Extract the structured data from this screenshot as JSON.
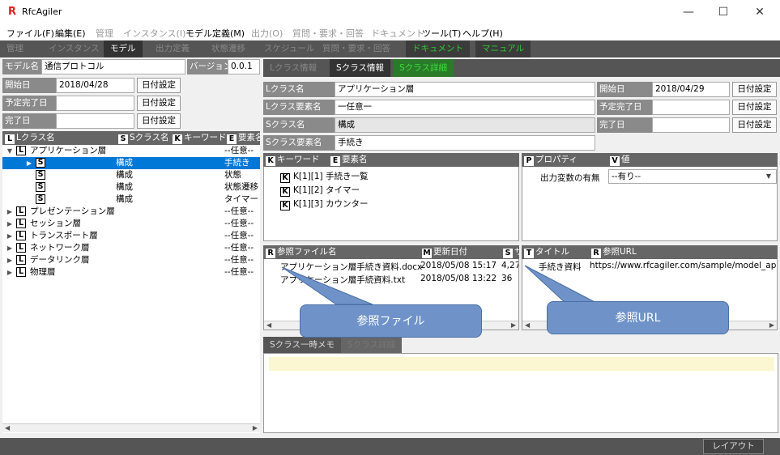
{
  "app": {
    "title": "RfcAgiler",
    "logo": "R"
  },
  "window_controls": {
    "minimize": "—",
    "maximize": "☐",
    "close": "✕"
  },
  "menu": [
    "ファイル(F)",
    "編集(E)",
    "管理",
    "インスタンス(I)",
    "モデル定義(M)",
    "出力(O)",
    "質問・要求・回答",
    "ドキュメント",
    "ツール(T)",
    "ヘルプ(H)"
  ],
  "top_tabs": [
    "管理",
    "インスタンス",
    "モデル",
    "出力定義",
    "状態遷移",
    "スケジュール",
    "質問・要求・回答",
    "ドキュメント",
    "マニュアル"
  ],
  "left": {
    "model_label": "モデル名",
    "model_value": "通信プロトコル",
    "version_label": "バージョン",
    "version_value": "0.0.1",
    "start_label": "開始日",
    "start_value": "2018/04/28",
    "planned_label": "予定完了日",
    "planned_value": "",
    "done_label": "完了日",
    "done_value": "",
    "date_btn": "日付設定",
    "tree_headers": {
      "l_badge": "L",
      "l": "Lクラス名",
      "s_badge": "S",
      "s": "Sクラス名",
      "k_badge": "K",
      "k": "キーワード",
      "e_badge": "E",
      "e": "要素名"
    },
    "tree": [
      {
        "arrow": "▼",
        "badge": "L",
        "name": "アプリケーション層",
        "s": "",
        "el": "--任意--",
        "indent": 0,
        "selected": false
      },
      {
        "arrow": "▶",
        "badge": "S",
        "name": "",
        "s": "構成",
        "el": "手続き",
        "indent": 1,
        "selected": true
      },
      {
        "arrow": "",
        "badge": "S",
        "name": "",
        "s": "構成",
        "el": "状態",
        "indent": 1,
        "selected": false
      },
      {
        "arrow": "",
        "badge": "S",
        "name": "",
        "s": "構成",
        "el": "状態遷移",
        "indent": 1,
        "selected": false
      },
      {
        "arrow": "",
        "badge": "S",
        "name": "",
        "s": "構成",
        "el": "タイマー",
        "indent": 1,
        "selected": false
      },
      {
        "arrow": "▶",
        "badge": "L",
        "name": "プレゼンテーション層",
        "s": "",
        "el": "--任意--",
        "indent": 0,
        "selected": false
      },
      {
        "arrow": "▶",
        "badge": "L",
        "name": "セッション層",
        "s": "",
        "el": "--任意--",
        "indent": 0,
        "selected": false
      },
      {
        "arrow": "▶",
        "badge": "L",
        "name": "トランスポート層",
        "s": "",
        "el": "--任意--",
        "indent": 0,
        "selected": false
      },
      {
        "arrow": "▶",
        "badge": "L",
        "name": "ネットワーク層",
        "s": "",
        "el": "--任意--",
        "indent": 0,
        "selected": false
      },
      {
        "arrow": "▶",
        "badge": "L",
        "name": "データリンク層",
        "s": "",
        "el": "--任意--",
        "indent": 0,
        "selected": false
      },
      {
        "arrow": "▶",
        "badge": "L",
        "name": "物理層",
        "s": "",
        "el": "--任意--",
        "indent": 0,
        "selected": false
      }
    ]
  },
  "right": {
    "tabs": [
      "Lクラス情報",
      "Sクラス情報",
      "Sクラス詳細"
    ],
    "l_name_label": "Lクラス名",
    "l_name_value": "アプリケーション層",
    "l_elem_label": "Lクラス要素名",
    "l_elem_value": "一任意一",
    "s_name_label": "Sクラス名",
    "s_name_value": "構成",
    "s_elem_label": "Sクラス要素名",
    "s_elem_value": "手続き",
    "start_label": "開始日",
    "start_value": "2018/04/29",
    "planned_label": "予定完了日",
    "planned_value": "",
    "done_label": "完了日",
    "done_value": "",
    "date_btn": "日付設定",
    "kw_header": {
      "k_badge": "K",
      "k": "キーワード",
      "e_badge": "E",
      "e": "要素名"
    },
    "keywords": [
      {
        "badge": "K",
        "text": "K[1][1] 手続き一覧"
      },
      {
        "badge": "K",
        "text": "K[1][2] タイマー"
      },
      {
        "badge": "K",
        "text": "K[1][3] カウンター"
      }
    ],
    "prop_header": {
      "p_badge": "P",
      "p": "プロパティ",
      "v_badge": "V",
      "v": "値"
    },
    "prop": {
      "label": "出力変数の有無",
      "value": "--有り--"
    },
    "ref_header": {
      "r_badge": "R",
      "r": "参照ファイル名",
      "m_badge": "M",
      "m": "更新日付",
      "s_badge": "S",
      "s": "サ"
    },
    "ref_files": [
      {
        "name": "アプリケーション層手続き資料.docx",
        "date": "2018/05/08 15:17",
        "size": "4,27"
      },
      {
        "name": "アプリケーション層手続資料.txt",
        "date": "2018/05/08 13:22",
        "size": "36"
      }
    ],
    "url_header": {
      "t_badge": "T",
      "t": "タイトル",
      "r_badge": "R",
      "r": "参照URL"
    },
    "urls": [
      {
        "title": "手続き資料",
        "url": "https://www.rfcagiler.com/sample/model_ap"
      }
    ],
    "memo_tabs": [
      "Sクラス一時メモ",
      "Sクラス詳細"
    ],
    "callout_files": "参照ファイル",
    "callout_url": "参照URL"
  },
  "status": {
    "layout_btn": "レイアウト"
  },
  "colors": {
    "accent": "#0078d7",
    "green_tab": "#2ecc2e",
    "callout": "#6f93c9",
    "memo_line": "#fbf7d2"
  }
}
